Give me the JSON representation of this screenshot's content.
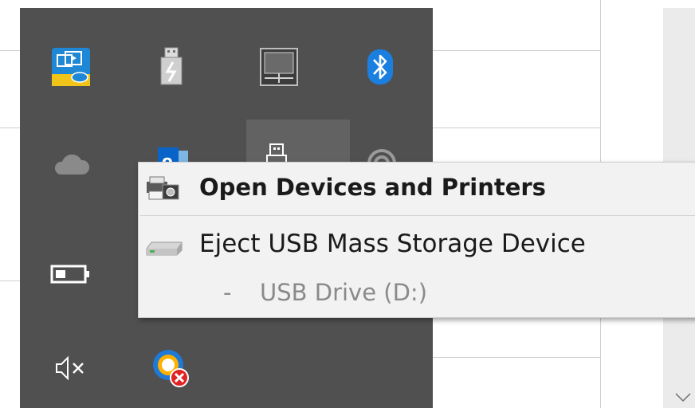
{
  "context_menu": {
    "items": [
      {
        "label": "Open Devices and Printers",
        "icon": "devices-printers-icon",
        "bold": true
      },
      {
        "label": "Eject USB Mass Storage Device",
        "icon": "usb-drive-icon"
      }
    ],
    "sub_item": {
      "prefix": "-",
      "label": "USB Drive (D:)"
    }
  },
  "tray_icons": [
    "intel-graphics-icon",
    "safely-remove-hardware-icon",
    "touchpad-icon",
    "bluetooth-icon",
    "onedrive-icon",
    "outlook-icon",
    "usb-icon",
    "cloud-icon",
    "battery-icon",
    "volume-muted-icon",
    "security-warning-icon"
  ],
  "colors": {
    "tray_background": "#505050",
    "menu_background": "#f2f2f2",
    "bluetooth_blue": "#1b7fe0",
    "disabled_text": "#8a8a8a"
  }
}
